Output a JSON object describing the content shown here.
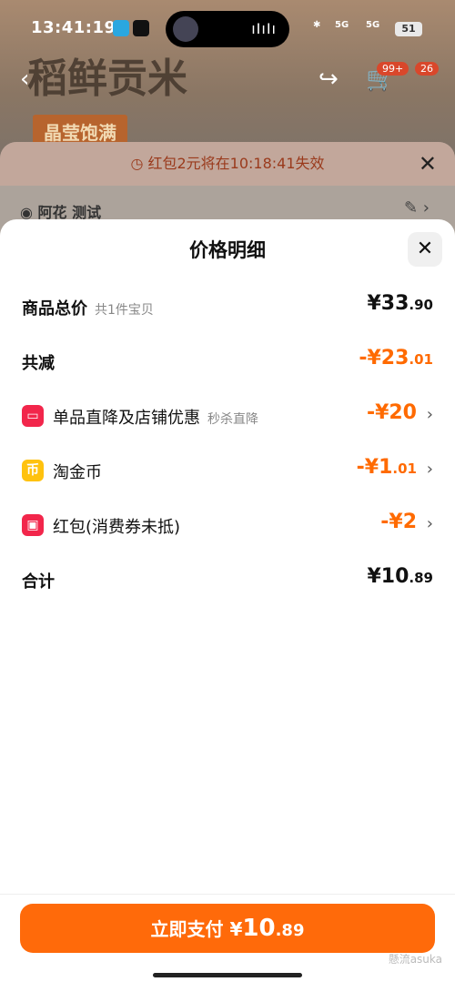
{
  "status_bar": {
    "time": "13:41:19",
    "signal_labels": [
      "5G",
      "5G"
    ],
    "battery": "51"
  },
  "background": {
    "product_title": "稻鲜贡米",
    "badge": "晶莹饱满",
    "cart_count": "99+",
    "extra_badge": "26"
  },
  "notice": {
    "text": "红包2元将在10:18:41失效",
    "address": "阿花 测试"
  },
  "panel": {
    "title": "价格明细",
    "rows": [
      {
        "label": "商品总价",
        "sub": "共1件宝贝",
        "amount_main": "¥33",
        "amount_dec": ".90"
      },
      {
        "label": "共减",
        "amount_main": "-¥23",
        "amount_dec": ".01"
      },
      {
        "label": "单品直降及店铺优惠",
        "sub": "秒杀直降",
        "amount_main": "-¥20",
        "amount_dec": "",
        "icon": "shop-discount-icon"
      },
      {
        "label": "淘金币",
        "amount_main": "-¥1",
        "amount_dec": ".01",
        "icon": "coin-icon"
      },
      {
        "label": "红包(消费券未抵)",
        "amount_main": "-¥2",
        "amount_dec": "",
        "icon": "red-packet-icon"
      },
      {
        "label": "合计",
        "amount_main": "¥10",
        "amount_dec": ".89"
      }
    ]
  },
  "pay": {
    "label": "立即支付 ¥",
    "amount_main": "10",
    "amount_dec": ".89"
  },
  "watermark": "懸流asuka",
  "colors": {
    "accent": "#ff6a00",
    "pay_button": "#ff6a0a"
  }
}
